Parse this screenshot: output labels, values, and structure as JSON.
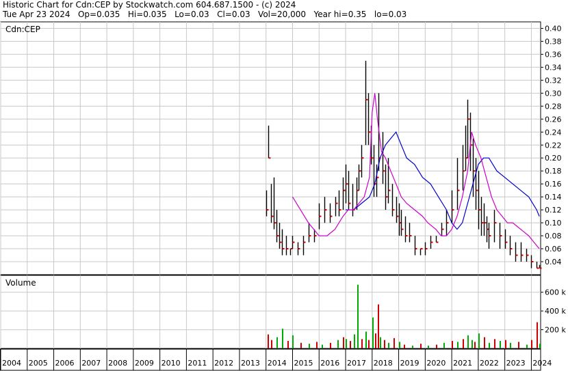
{
  "header": {
    "line1": "Historic Chart for Cdn:CEP by Stockwatch.com 604.687.1500 - (c) 2024",
    "line2": "Tue Apr 23 2024   Op=0.035   Hi=0.035   Lo=0.03   Cl=0.03   Vol=20,000   Year hi=0.35   lo=0.03"
  },
  "price_panel": {
    "label": "Cdn:CEP"
  },
  "volume_panel": {
    "label": "Volume"
  },
  "colors": {
    "price_bar": "#000000",
    "close_marker": "#cc0000",
    "ma_short": "#cc00cc",
    "ma_long": "#0000cc",
    "grid": "#c8c8c8",
    "vol_up": "#00aa00",
    "vol_down": "#cc0000"
  },
  "chart_data": [
    {
      "type": "line",
      "title": "",
      "ylim": [
        0.02,
        0.41
      ],
      "y_ticks": [
        "0.40",
        "0.38",
        "0.36",
        "0.34",
        "0.32",
        "0.30",
        "0.28",
        "0.26",
        "0.24",
        "0.22",
        "0.20",
        "0.18",
        "0.16",
        "0.14",
        "0.12",
        "0.10",
        "0.08",
        "0.06",
        "0.04"
      ],
      "x_ticks": [
        "2004",
        "2005",
        "2006",
        "2007",
        "2008",
        "2009",
        "2010",
        "2011",
        "2012",
        "2013",
        "2014",
        "2015",
        "2016",
        "2017",
        "2018",
        "2019",
        "2020",
        "2021",
        "2022",
        "2023",
        "2024"
      ],
      "grid": true,
      "price_series": {
        "name": "price",
        "x": [
          2014.0,
          2014.08,
          2014.2,
          2014.3,
          2014.4,
          2014.5,
          2014.6,
          2014.75,
          2014.9,
          2015.0,
          2015.2,
          2015.4,
          2015.6,
          2015.8,
          2016.0,
          2016.2,
          2016.4,
          2016.6,
          2016.75,
          2016.9,
          2017.0,
          2017.1,
          2017.25,
          2017.4,
          2017.5,
          2017.6,
          2017.75,
          2017.85,
          2017.95,
          2018.05,
          2018.15,
          2018.25,
          2018.4,
          2018.5,
          2018.6,
          2018.75,
          2018.9,
          2019.0,
          2019.1,
          2019.25,
          2019.4,
          2019.6,
          2019.8,
          2020.0,
          2020.2,
          2020.4,
          2020.6,
          2020.8,
          2021.0,
          2021.2,
          2021.4,
          2021.5,
          2021.6,
          2021.7,
          2021.8,
          2021.9,
          2022.0,
          2022.1,
          2022.2,
          2022.3,
          2022.4,
          2022.6,
          2022.8,
          2023.0,
          2023.2,
          2023.4,
          2023.6,
          2023.8,
          2024.0,
          2024.2,
          2024.3
        ],
        "high": [
          0.15,
          0.25,
          0.16,
          0.17,
          0.12,
          0.1,
          0.09,
          0.08,
          0.06,
          0.08,
          0.07,
          0.08,
          0.1,
          0.09,
          0.13,
          0.14,
          0.13,
          0.14,
          0.15,
          0.17,
          0.19,
          0.18,
          0.16,
          0.17,
          0.19,
          0.22,
          0.35,
          0.3,
          0.25,
          0.22,
          0.19,
          0.3,
          0.24,
          0.19,
          0.2,
          0.16,
          0.14,
          0.13,
          0.12,
          0.11,
          0.1,
          0.08,
          0.06,
          0.07,
          0.08,
          0.08,
          0.1,
          0.12,
          0.15,
          0.2,
          0.22,
          0.25,
          0.29,
          0.27,
          0.23,
          0.2,
          0.18,
          0.14,
          0.13,
          0.11,
          0.1,
          0.12,
          0.1,
          0.09,
          0.08,
          0.07,
          0.07,
          0.06,
          0.05,
          0.04,
          0.035
        ],
        "low": [
          0.11,
          0.2,
          0.1,
          0.09,
          0.07,
          0.06,
          0.05,
          0.05,
          0.05,
          0.06,
          0.05,
          0.05,
          0.07,
          0.07,
          0.09,
          0.1,
          0.1,
          0.11,
          0.11,
          0.12,
          0.13,
          0.12,
          0.11,
          0.12,
          0.15,
          0.17,
          0.22,
          0.22,
          0.19,
          0.14,
          0.14,
          0.18,
          0.16,
          0.12,
          0.13,
          0.11,
          0.1,
          0.08,
          0.08,
          0.07,
          0.07,
          0.05,
          0.05,
          0.05,
          0.06,
          0.07,
          0.08,
          0.08,
          0.1,
          0.12,
          0.15,
          0.18,
          0.2,
          0.18,
          0.14,
          0.12,
          0.09,
          0.08,
          0.08,
          0.07,
          0.06,
          0.07,
          0.06,
          0.06,
          0.05,
          0.04,
          0.04,
          0.04,
          0.03,
          0.03,
          0.03
        ],
        "close": [
          0.12,
          0.2,
          0.11,
          0.1,
          0.08,
          0.07,
          0.06,
          0.06,
          0.06,
          0.07,
          0.06,
          0.07,
          0.08,
          0.08,
          0.11,
          0.12,
          0.11,
          0.13,
          0.12,
          0.15,
          0.16,
          0.13,
          0.12,
          0.15,
          0.18,
          0.2,
          0.29,
          0.24,
          0.2,
          0.16,
          0.17,
          0.2,
          0.18,
          0.14,
          0.15,
          0.12,
          0.11,
          0.1,
          0.09,
          0.08,
          0.08,
          0.06,
          0.06,
          0.06,
          0.07,
          0.07,
          0.09,
          0.1,
          0.12,
          0.15,
          0.18,
          0.2,
          0.26,
          0.22,
          0.18,
          0.15,
          0.12,
          0.1,
          0.1,
          0.09,
          0.08,
          0.1,
          0.08,
          0.07,
          0.06,
          0.05,
          0.05,
          0.05,
          0.04,
          0.03,
          0.03
        ]
      },
      "ma_short": {
        "name": "ma_short",
        "x": [
          2015.0,
          2015.3,
          2015.6,
          2016.0,
          2016.3,
          2016.6,
          2016.9,
          2017.1,
          2017.3,
          2017.5,
          2017.7,
          2017.9,
          2018.0,
          2018.1,
          2018.2,
          2018.35,
          2018.5,
          2018.7,
          2018.9,
          2019.1,
          2019.3,
          2019.6,
          2019.9,
          2020.1,
          2020.4,
          2020.6,
          2020.8,
          2021.0,
          2021.2,
          2021.4,
          2021.6,
          2021.75,
          2021.9,
          2022.1,
          2022.3,
          2022.5,
          2022.7,
          2022.9,
          2023.1,
          2023.3,
          2023.6,
          2023.9,
          2024.1,
          2024.3
        ],
        "y": [
          0.14,
          0.12,
          0.1,
          0.08,
          0.08,
          0.09,
          0.11,
          0.12,
          0.12,
          0.13,
          0.14,
          0.17,
          0.27,
          0.3,
          0.26,
          0.21,
          0.2,
          0.18,
          0.16,
          0.14,
          0.13,
          0.12,
          0.11,
          0.1,
          0.09,
          0.08,
          0.08,
          0.09,
          0.11,
          0.14,
          0.18,
          0.24,
          0.22,
          0.2,
          0.17,
          0.14,
          0.12,
          0.11,
          0.1,
          0.1,
          0.09,
          0.08,
          0.07,
          0.06
        ]
      },
      "ma_long": {
        "name": "ma_long",
        "x": [
          2017.0,
          2017.3,
          2017.6,
          2017.9,
          2018.1,
          2018.3,
          2018.5,
          2018.7,
          2018.9,
          2019.1,
          2019.3,
          2019.6,
          2019.9,
          2020.2,
          2020.5,
          2020.8,
          2021.0,
          2021.2,
          2021.4,
          2021.6,
          2021.8,
          2022.0,
          2022.2,
          2022.4,
          2022.7,
          2023.0,
          2023.3,
          2023.6,
          2023.9,
          2024.2,
          2024.3
        ],
        "y": [
          0.12,
          0.12,
          0.13,
          0.14,
          0.16,
          0.2,
          0.22,
          0.23,
          0.24,
          0.22,
          0.2,
          0.19,
          0.17,
          0.16,
          0.14,
          0.12,
          0.1,
          0.09,
          0.1,
          0.13,
          0.16,
          0.19,
          0.2,
          0.2,
          0.18,
          0.17,
          0.16,
          0.15,
          0.14,
          0.12,
          0.11
        ]
      }
    },
    {
      "type": "bar",
      "title": "",
      "ylabel": "Volume",
      "ylim": [
        0,
        780000
      ],
      "y_ticks": [
        "600 k",
        "400 k",
        "200 k"
      ],
      "y_tick_values": [
        600000,
        400000,
        200000
      ],
      "grid": true,
      "x": [
        2014.05,
        2014.2,
        2014.4,
        2014.6,
        2014.8,
        2015.0,
        2015.3,
        2015.6,
        2015.9,
        2016.1,
        2016.4,
        2016.7,
        2016.9,
        2017.0,
        2017.15,
        2017.3,
        2017.45,
        2017.6,
        2017.75,
        2017.85,
        2018.0,
        2018.1,
        2018.2,
        2018.3,
        2018.45,
        2018.6,
        2018.8,
        2019.0,
        2019.2,
        2019.5,
        2019.8,
        2020.1,
        2020.4,
        2020.7,
        2021.0,
        2021.2,
        2021.4,
        2021.6,
        2021.75,
        2021.85,
        2022.0,
        2022.2,
        2022.4,
        2022.6,
        2022.8,
        2023.0,
        2023.2,
        2023.5,
        2023.8,
        2024.0,
        2024.2,
        2024.3
      ],
      "values": [
        150000,
        90000,
        120000,
        210000,
        80000,
        140000,
        60000,
        50000,
        70000,
        40000,
        60000,
        90000,
        120000,
        100000,
        80000,
        150000,
        680000,
        100000,
        180000,
        90000,
        330000,
        160000,
        470000,
        120000,
        90000,
        60000,
        110000,
        70000,
        40000,
        30000,
        50000,
        30000,
        40000,
        60000,
        80000,
        70000,
        100000,
        140000,
        90000,
        70000,
        160000,
        120000,
        60000,
        100000,
        80000,
        90000,
        60000,
        70000,
        40000,
        90000,
        280000,
        50000
      ],
      "up": [
        false,
        false,
        true,
        true,
        false,
        true,
        false,
        true,
        false,
        true,
        false,
        true,
        false,
        true,
        false,
        true,
        true,
        false,
        true,
        false,
        true,
        false,
        false,
        true,
        false,
        true,
        false,
        true,
        false,
        true,
        false,
        true,
        false,
        true,
        false,
        true,
        false,
        true,
        true,
        false,
        true,
        false,
        true,
        false,
        true,
        false,
        true,
        false,
        true,
        false,
        false,
        true
      ]
    }
  ]
}
